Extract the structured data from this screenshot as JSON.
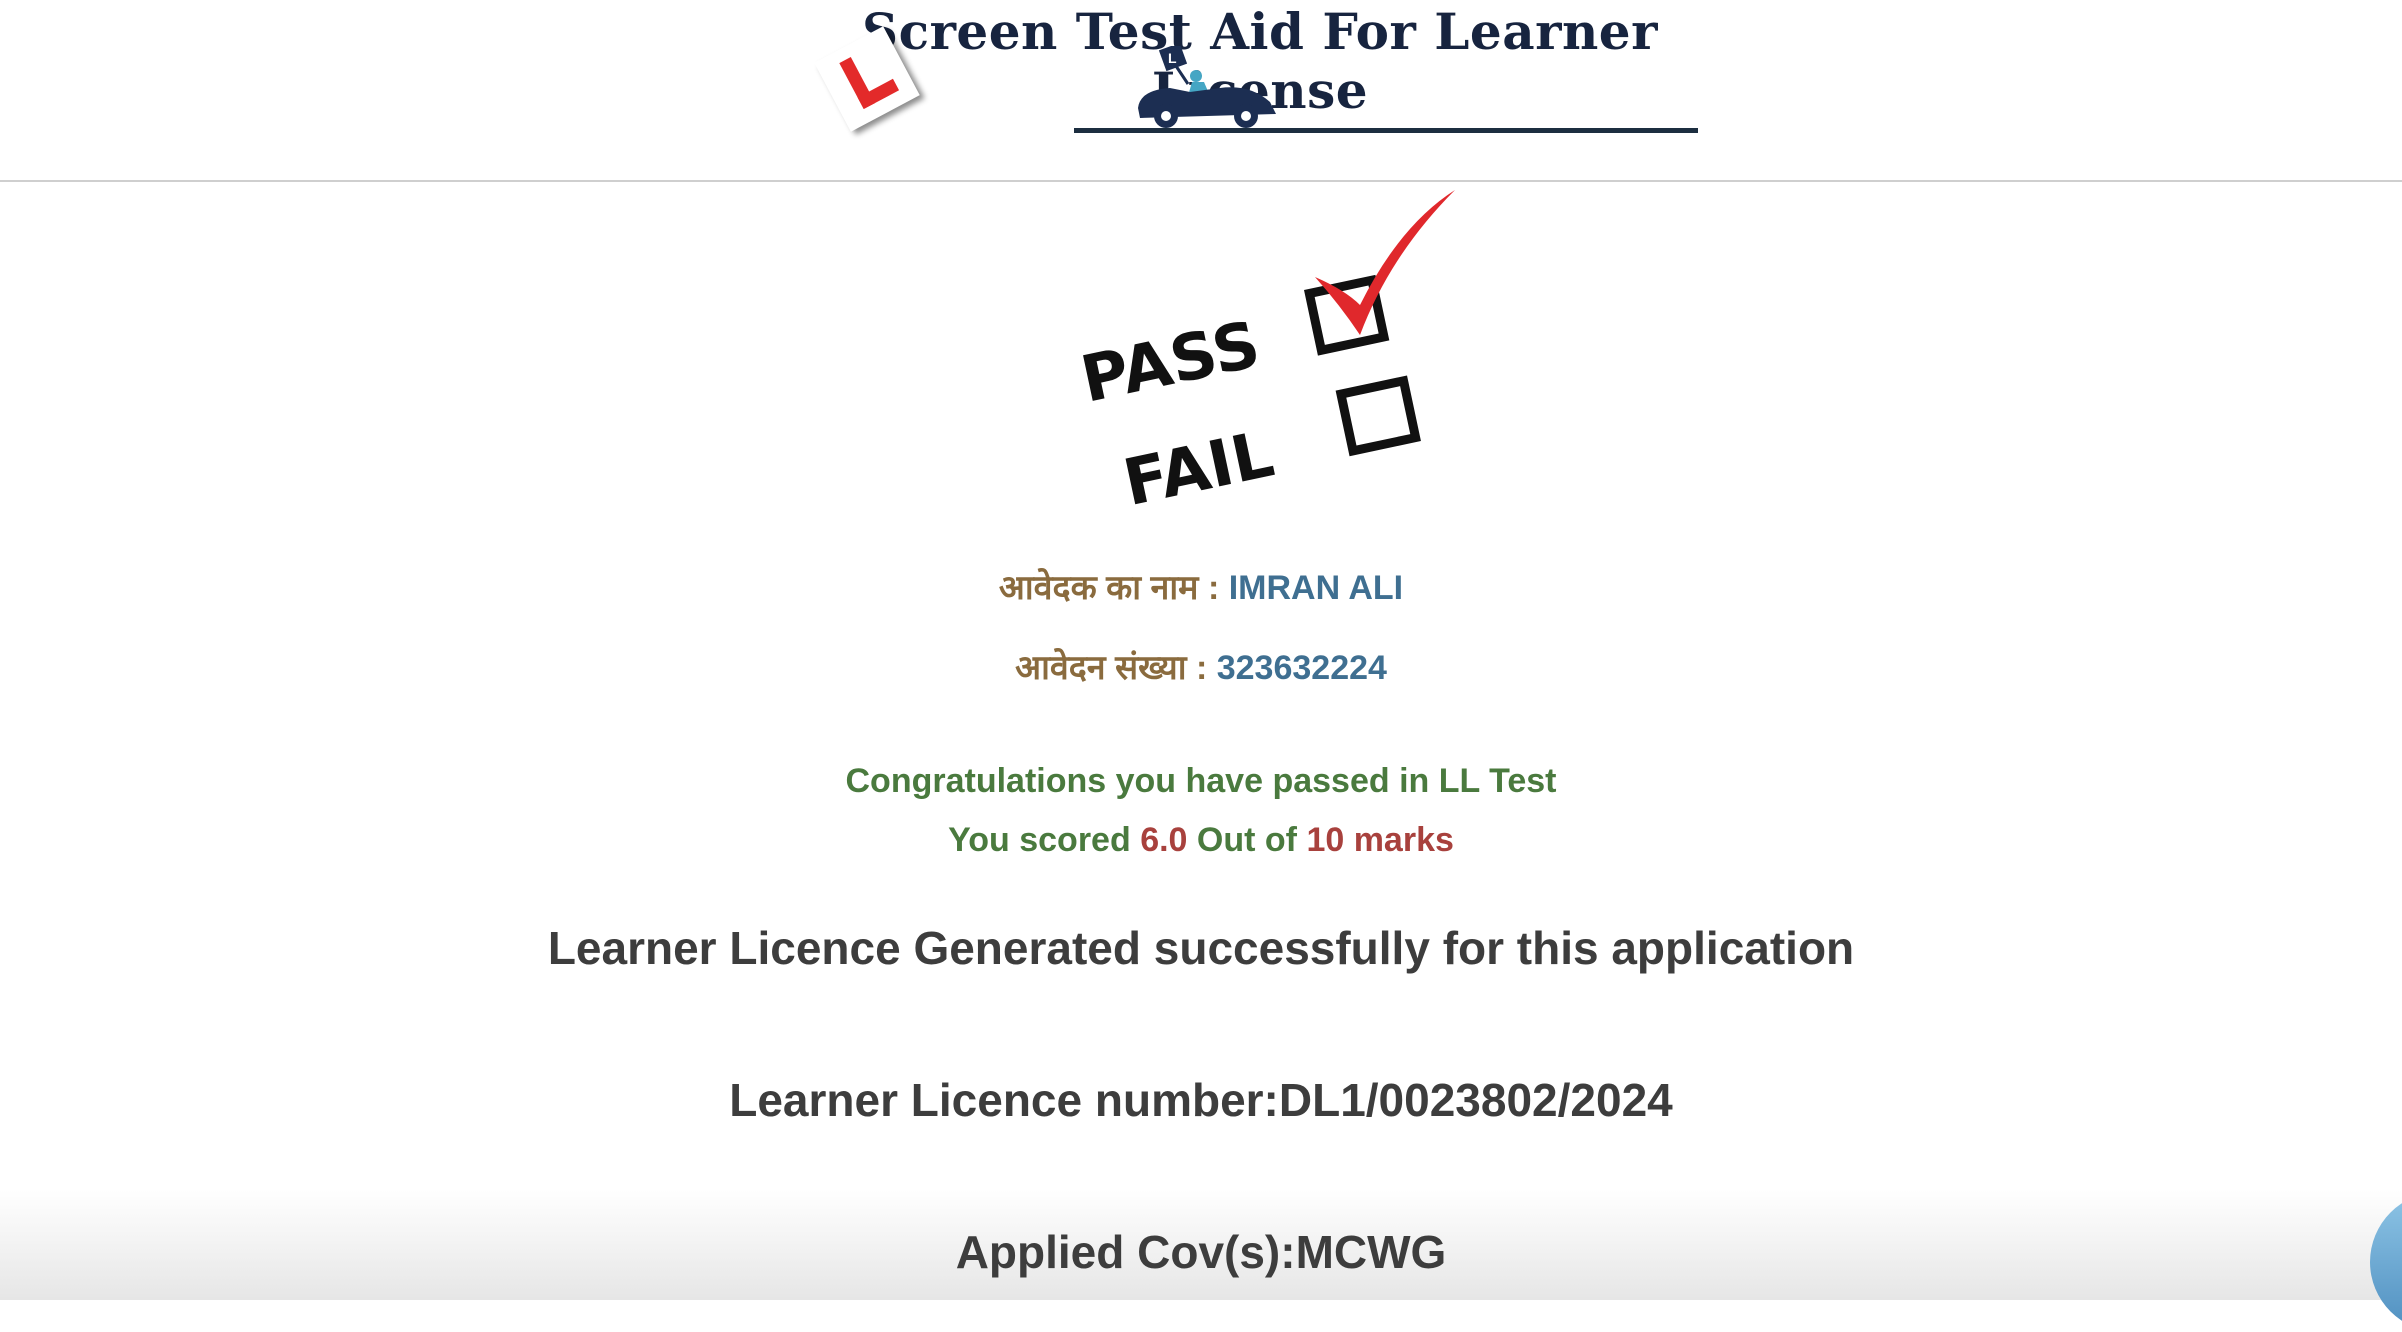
{
  "header": {
    "title": "Screen Test Aid For Learner License"
  },
  "result_image": {
    "pass_label": "PASS",
    "fail_label": "FAIL"
  },
  "applicant": {
    "name_label": "आवेदक का नाम :",
    "name_value": "IMRAN ALI",
    "app_no_label": "आवेदन संख्या :",
    "app_no_value": "323632224"
  },
  "result": {
    "congrats": "Congratulations you have passed in LL Test",
    "score_prefix": "You scored",
    "score": "6.0",
    "score_mid": "Out of",
    "total": "10 marks"
  },
  "licence": {
    "generated": "Learner Licence Generated successfully for this application",
    "number": "Learner Licence number:DL1/0023802/2024",
    "cov": "Applied Cov(s):MCWG"
  },
  "colors": {
    "title": "#17243f",
    "label": "#8a6b3e",
    "value": "#3f6f91",
    "success": "#4a7a3e",
    "score": "#a8413d"
  }
}
